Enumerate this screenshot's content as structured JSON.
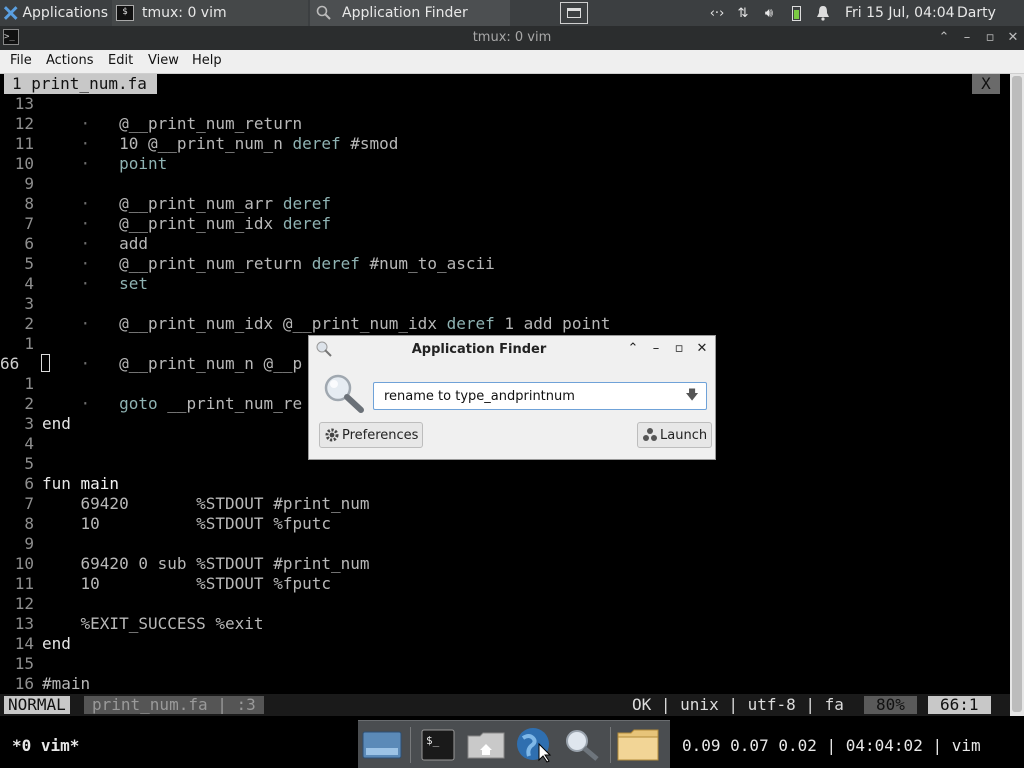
{
  "panel": {
    "applications_label": "Applications",
    "task_tmux_label": "tmux: 0 vim",
    "task_finder_label": "Application Finder",
    "clock": "Fri 15 Jul, 04:04",
    "user": "Darty uwu"
  },
  "window": {
    "title": "tmux: 0 vim",
    "menu": [
      "File",
      "Actions",
      "Edit",
      "View",
      "Help"
    ]
  },
  "vim": {
    "tab_label": "1 print_num.fa",
    "tab_close": "X",
    "lines": [
      {
        "num": "13",
        "parts": []
      },
      {
        "num": "12",
        "parts": [
          {
            "c": "dot",
            "t": "    ·   "
          },
          {
            "c": "t",
            "t": "@__print_num_return"
          }
        ]
      },
      {
        "num": "11",
        "parts": [
          {
            "c": "dot",
            "t": "    ·   "
          },
          {
            "c": "t",
            "t": "10 @__print_num_n "
          },
          {
            "c": "d",
            "t": "deref"
          },
          {
            "c": "t",
            "t": " #smod"
          }
        ]
      },
      {
        "num": "10",
        "parts": [
          {
            "c": "dot",
            "t": "    ·   "
          },
          {
            "c": "d",
            "t": "point"
          }
        ]
      },
      {
        "num": "9",
        "parts": []
      },
      {
        "num": "8",
        "parts": [
          {
            "c": "dot",
            "t": "    ·   "
          },
          {
            "c": "t",
            "t": "@__print_num_arr "
          },
          {
            "c": "d",
            "t": "deref"
          }
        ]
      },
      {
        "num": "7",
        "parts": [
          {
            "c": "dot",
            "t": "    ·   "
          },
          {
            "c": "t",
            "t": "@__print_num_idx "
          },
          {
            "c": "d",
            "t": "deref"
          }
        ]
      },
      {
        "num": "6",
        "parts": [
          {
            "c": "dot",
            "t": "    ·   "
          },
          {
            "c": "t",
            "t": "add"
          }
        ]
      },
      {
        "num": "5",
        "parts": [
          {
            "c": "dot",
            "t": "    ·   "
          },
          {
            "c": "t",
            "t": "@__print_num_return "
          },
          {
            "c": "d",
            "t": "deref"
          },
          {
            "c": "t",
            "t": " #num_to_ascii"
          }
        ]
      },
      {
        "num": "4",
        "parts": [
          {
            "c": "dot",
            "t": "    ·   "
          },
          {
            "c": "d",
            "t": "set"
          }
        ]
      },
      {
        "num": "3",
        "parts": []
      },
      {
        "num": "2",
        "parts": [
          {
            "c": "dot",
            "t": "    ·   "
          },
          {
            "c": "t",
            "t": "@__print_num_idx @__print_num_idx "
          },
          {
            "c": "d",
            "t": "deref"
          },
          {
            "c": "t",
            "t": " 1 add point"
          }
        ]
      },
      {
        "num": "1",
        "parts": []
      },
      {
        "num": "66",
        "current": true,
        "parts": [
          {
            "c": "dot",
            "t": "    ·   "
          },
          {
            "c": "t",
            "t": "@__print_num_n @__p"
          }
        ]
      },
      {
        "num": "1",
        "parts": []
      },
      {
        "num": "2",
        "parts": [
          {
            "c": "dot",
            "t": "    ·   "
          },
          {
            "c": "d",
            "t": "goto"
          },
          {
            "c": "t",
            "t": " __print_num_re"
          }
        ]
      },
      {
        "num": "3",
        "parts": [
          {
            "c": "kw",
            "t": "end"
          }
        ]
      },
      {
        "num": "4",
        "parts": []
      },
      {
        "num": "5",
        "parts": []
      },
      {
        "num": "6",
        "parts": [
          {
            "c": "kw",
            "t": "fun "
          },
          {
            "c": "fn",
            "t": "main"
          }
        ]
      },
      {
        "num": "7",
        "parts": [
          {
            "c": "t",
            "t": "    69420       %STDOUT #print_num"
          }
        ]
      },
      {
        "num": "8",
        "parts": [
          {
            "c": "t",
            "t": "    10          %STDOUT %fputc"
          }
        ]
      },
      {
        "num": "9",
        "parts": []
      },
      {
        "num": "10",
        "parts": [
          {
            "c": "t",
            "t": "    69420 0 sub %STDOUT #print_num"
          }
        ]
      },
      {
        "num": "11",
        "parts": [
          {
            "c": "t",
            "t": "    10          %STDOUT %fputc"
          }
        ]
      },
      {
        "num": "12",
        "parts": []
      },
      {
        "num": "13",
        "parts": [
          {
            "c": "t",
            "t": "    %EXIT_SUCCESS %exit"
          }
        ]
      },
      {
        "num": "14",
        "parts": [
          {
            "c": "kw",
            "t": "end"
          }
        ]
      },
      {
        "num": "15",
        "parts": []
      },
      {
        "num": "16",
        "parts": [
          {
            "c": "t",
            "t": "#main"
          }
        ]
      }
    ],
    "status": {
      "mode": "NORMAL",
      "file": "print_num.fa  |  :3",
      "info": "OK  |  unix  |  utf-8  |  fa",
      "percent": "80%",
      "position": "66:1"
    }
  },
  "tmux": {
    "window": "*0 vim*",
    "right": "0.09 0.07 0.02  |  04:04:02  |  vim"
  },
  "finder": {
    "title": "Application Finder",
    "input_value": "rename to type_andprintnum",
    "preferences_label": "Preferences",
    "launch_label": "Launch"
  },
  "dock": [
    "show-desktop",
    "terminal",
    "home-folder",
    "web-browser",
    "app-finder",
    "file-manager"
  ]
}
